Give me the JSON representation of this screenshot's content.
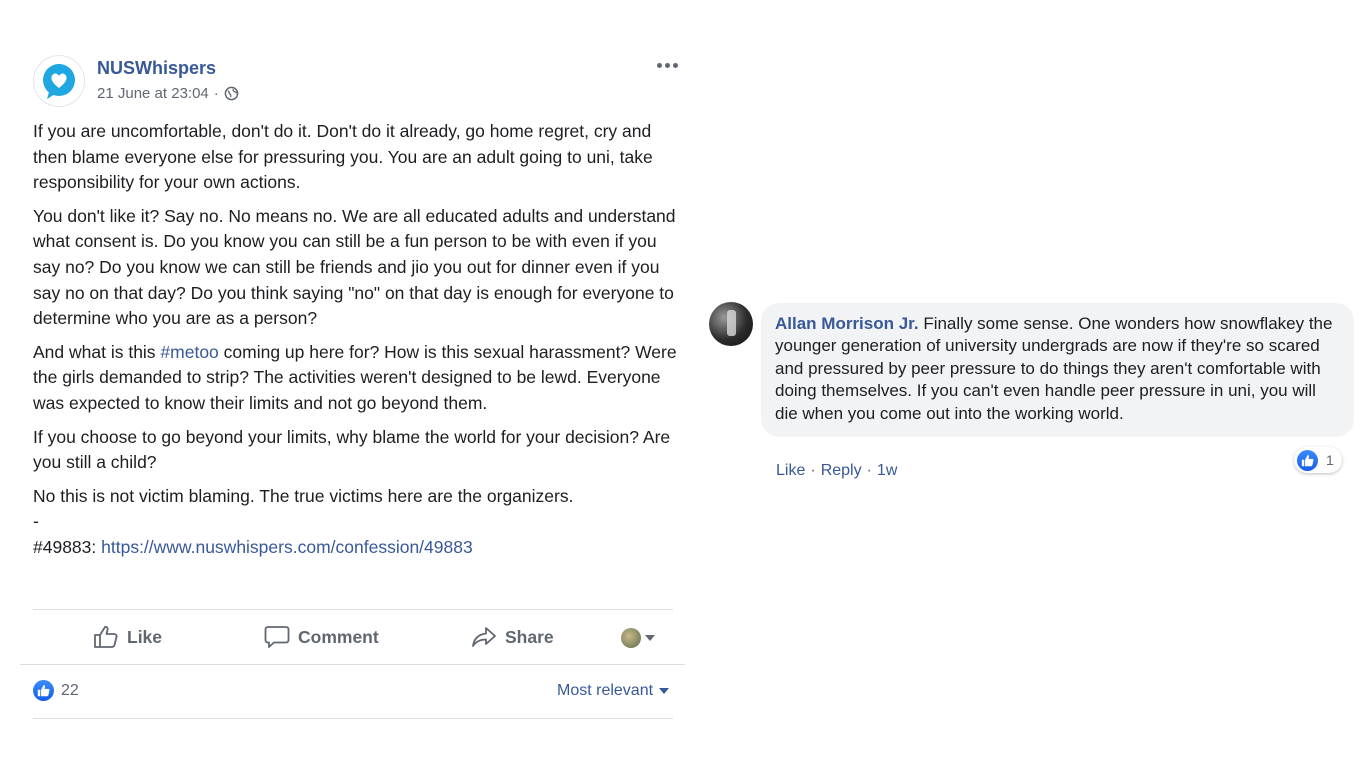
{
  "post": {
    "page_name": "NUSWhispers",
    "timestamp": "21 June at 23:04",
    "privacy_icon": "globe-icon",
    "more_icon": "ellipsis-icon",
    "paragraphs": [
      "If you are uncomfortable, don't do it. Don't do it already, go home regret, cry and then blame everyone else for pressuring you. You are an adult going to uni, take responsibility for your own actions.",
      "You don't like it? Say no. No means no. We are all educated adults and understand what consent is. Do you know you can still be a fun person to be with even if you say no? Do you know we can still be friends and jio you out for dinner even if you say no on that day? Do you think saying \"no\" on that day is enough for everyone to determine who you are as a person?"
    ],
    "p3_before": "And what is this ",
    "p3_hashtag": "#metoo",
    "p3_after": " coming up here for? How is this sexual harassment? Were the girls demanded to strip? The activities weren't designed to be lewd. Everyone was expected to know their limits and not go beyond them.",
    "p4": "If you choose to go beyond your limits, why blame the world for your decision? Are you still a child?",
    "p5": "No this is not victim blaming. The true victims here are the organizers.",
    "dash": "-",
    "confession_id": "#49883: ",
    "confession_link": "https://www.nuswhispers.com/confession/49883"
  },
  "actions": {
    "like": "Like",
    "comment": "Comment",
    "share": "Share"
  },
  "reactions": {
    "count": "22",
    "sort_label": "Most relevant"
  },
  "comment": {
    "author": "Allan Morrison Jr.",
    "text": " Finally some sense. One wonders how snowflakey the younger generation of university undergrads are now if they're so scared and pressured by peer pressure to do things they aren't comfortable with doing themselves. If you can't even handle peer pressure in uni, you will die when you come out into the working world.",
    "like": "Like",
    "reply": "Reply",
    "sep": "·",
    "ago": "1w",
    "reaction_count": "1"
  },
  "colors": {
    "link": "#385898",
    "muted": "#606770",
    "bubble": "#f2f3f5",
    "like_blue": "#1877f2"
  }
}
